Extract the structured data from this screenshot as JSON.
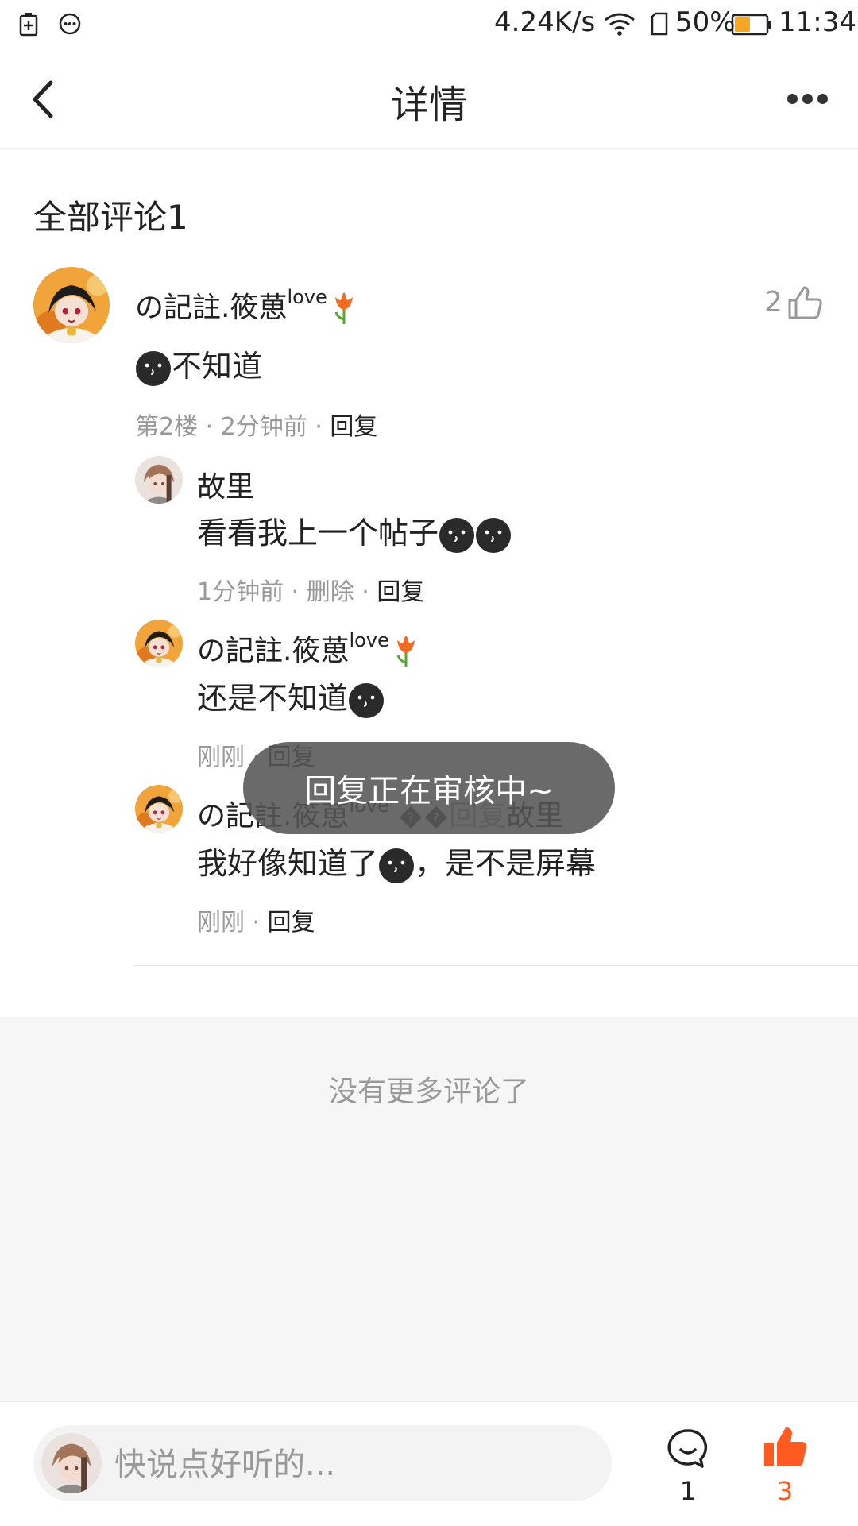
{
  "status_bar": {
    "network_speed": "4.24K/s",
    "battery_percent": "50%",
    "time": "11:34",
    "battery_level": 0.5,
    "icons": [
      "battery-saver-icon",
      "message-icon",
      "wifi-icon",
      "sim-icon",
      "battery-icon"
    ]
  },
  "header": {
    "title": "详情",
    "back_icon": "chevron-left-icon",
    "more_icon": "more-dots-icon"
  },
  "comments_section": {
    "title": "全部评论1"
  },
  "main_comment": {
    "username": "の記註.筱葸",
    "username_sup": "love",
    "text": "不知道",
    "floor": "第2楼",
    "time": "2分钟前",
    "reply_label": "回复",
    "like_count": "2"
  },
  "replies": [
    {
      "username": "故里",
      "text": "看看我上一个帖子",
      "time": "1分钟前",
      "delete_label": "删除",
      "reply_label": "回复"
    },
    {
      "username": "の記註.筱葸",
      "username_sup": "love",
      "text": "还是不知道",
      "time": "刚刚",
      "reply_label": "回复"
    },
    {
      "username": "の記註.筱葸",
      "username_sup": "love",
      "reply_to_label": "回复",
      "reply_to_user": "故里",
      "text_before_emoji": "我好像知道了",
      "text_after_emoji": "，是不是屏幕",
      "time": "刚刚",
      "reply_label": "回复"
    }
  ],
  "footer": {
    "no_more": "没有更多评论了"
  },
  "bottom_bar": {
    "input_placeholder": "快说点好听的...",
    "comment_count": "1",
    "like_count": "3",
    "like_color": "#ff5a1f"
  },
  "toast": {
    "text": "回复正在审核中~"
  },
  "colors": {
    "accent": "#ff5a1f",
    "meta_text": "#999999",
    "background_footer": "#f6f6f6"
  }
}
